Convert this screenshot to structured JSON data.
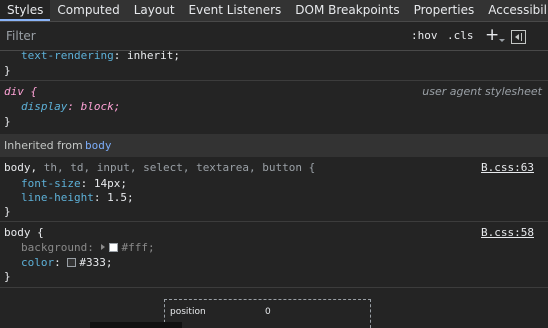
{
  "tabs": [
    "Styles",
    "Computed",
    "Layout",
    "Event Listeners",
    "DOM Breakpoints",
    "Properties",
    "Accessibility"
  ],
  "filter": {
    "placeholder": "Filter",
    "hov": ":hov",
    "cls": ".cls",
    "new_rule": "+"
  },
  "rules": {
    "prev": {
      "prop": "text-rendering",
      "val": "inherit;",
      "close": "}"
    },
    "div": {
      "selector": "div {",
      "source": "user agent stylesheet",
      "prop": "display",
      "val": "block;",
      "close": "}"
    },
    "inherited": {
      "label": "Inherited from",
      "element": "body"
    },
    "body_group": {
      "selector_main": "body,",
      "selector_rest": " th, td, input, select, textarea, button {",
      "source": "B.css:63",
      "decl1_prop": "font-size",
      "decl1_val": "14px;",
      "decl2_prop": "line-height",
      "decl2_val": "1.5;",
      "close": "}"
    },
    "body": {
      "selector": "body {",
      "source": "B.css:58",
      "decl1_prop": "background",
      "decl1_val": "#fff;",
      "decl2_prop": "color",
      "decl2_val": "#333;",
      "close": "}"
    }
  },
  "box_model": {
    "label": "position",
    "value": "0"
  },
  "colors": {
    "accent": "#8ab4f8",
    "property": "#5db0d7",
    "white_swatch": "#ffffff",
    "dark_swatch": "#333333"
  }
}
